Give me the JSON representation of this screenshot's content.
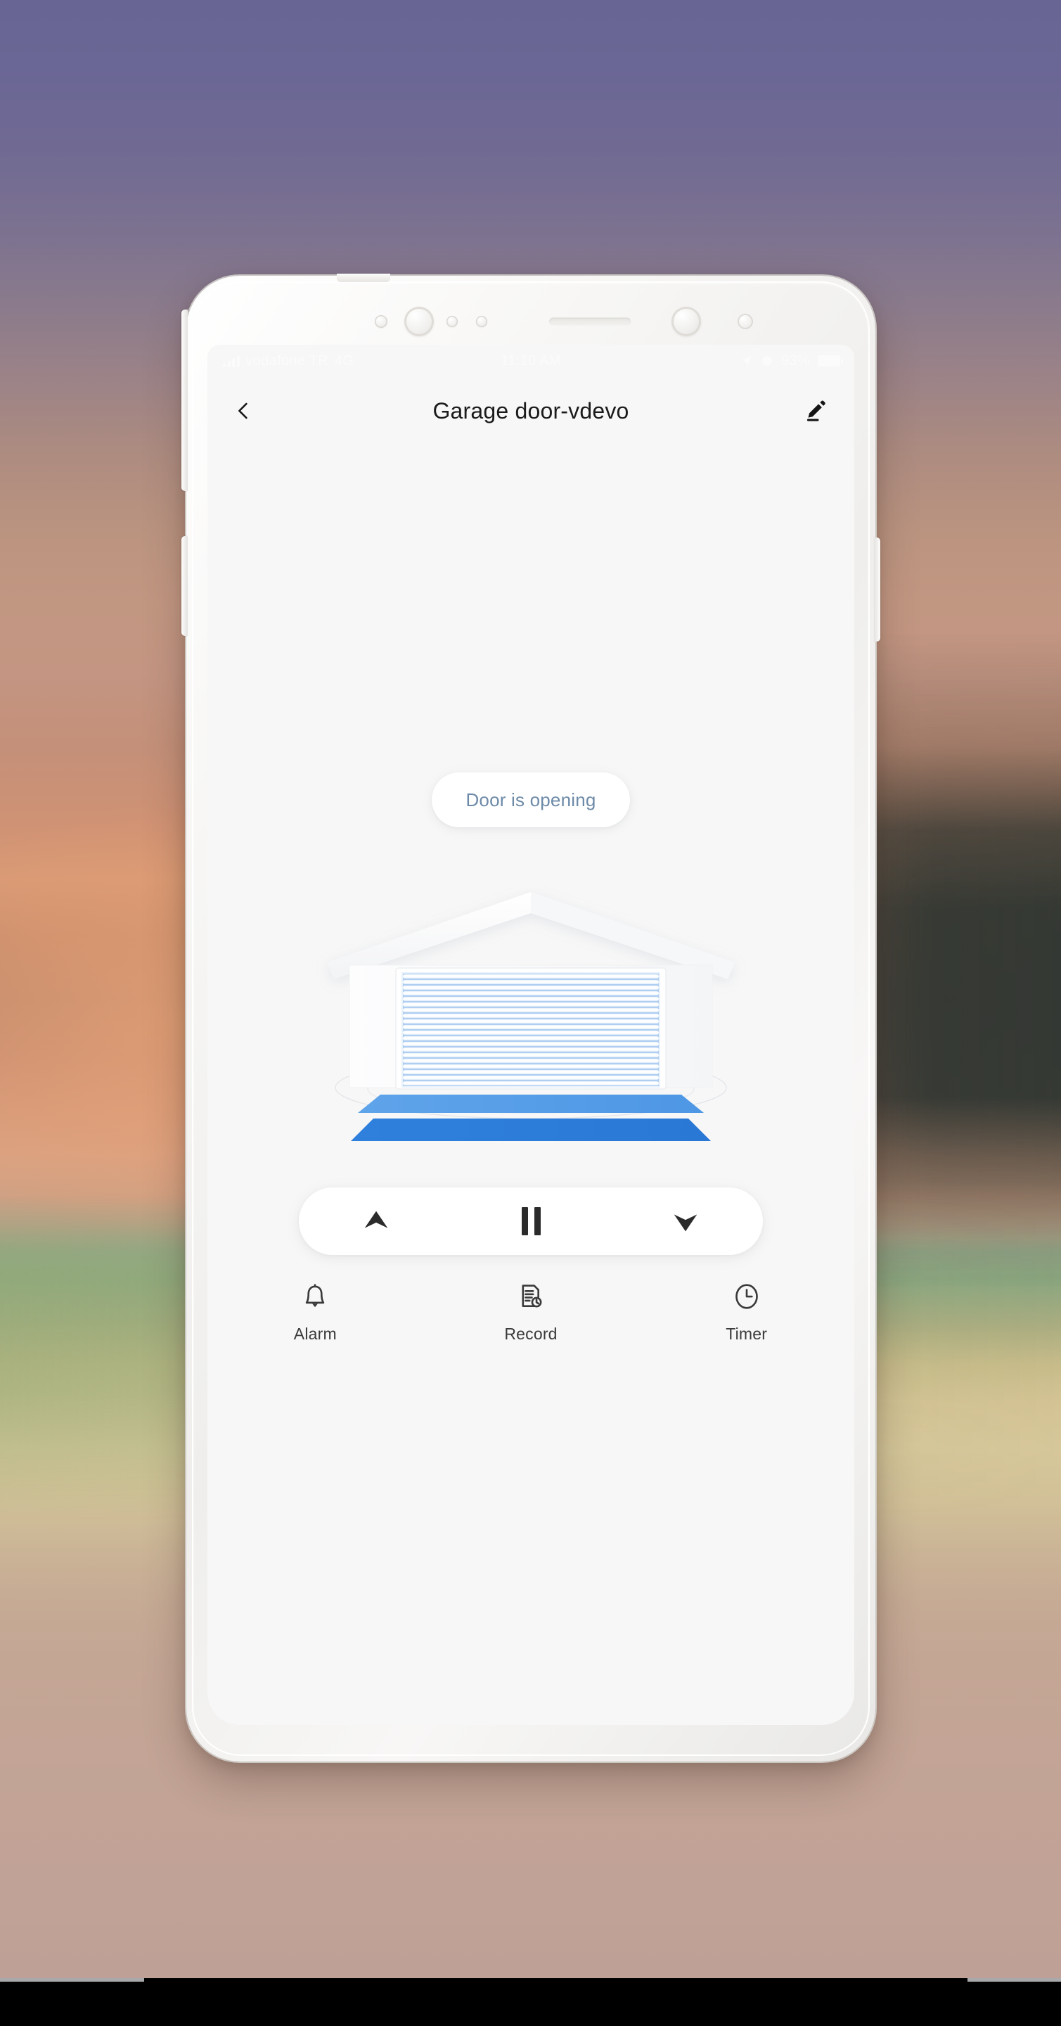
{
  "statusbar": {
    "carrier": "vodafone TR",
    "network": "4G",
    "time": "11:10 AM",
    "battery": "93%",
    "signal_icon": "signal-bars-icon",
    "location_icon": "location-arrow-icon",
    "wifi_icon": "wifi-icon",
    "battery_icon": "battery-icon"
  },
  "appbar": {
    "back_icon": "back-chevron-icon",
    "title": "Garage door-vdevo",
    "edit_icon": "pencil-edit-icon"
  },
  "status": {
    "text": "Door is opening",
    "color": "#6d8aa8"
  },
  "illustration": {
    "name": "garage-door-illustration",
    "door_state": "opening",
    "slat_count": 20,
    "colors": {
      "house": "#ffffff",
      "slat_gap": "#9fc4ee",
      "floor_front": "#2f80dd",
      "floor_back": "#5aa0e8"
    }
  },
  "controls": [
    {
      "name": "open-button",
      "icon": "chevron-up-icon",
      "label": "Open"
    },
    {
      "name": "pause-button",
      "icon": "pause-icon",
      "label": "Pause"
    },
    {
      "name": "close-button",
      "icon": "chevron-down-icon",
      "label": "Close"
    }
  ],
  "tabs": [
    {
      "label": "Alarm",
      "icon": "bell-icon"
    },
    {
      "label": "Record",
      "icon": "document-clock-icon"
    },
    {
      "label": "Timer",
      "icon": "clock-icon"
    }
  ]
}
